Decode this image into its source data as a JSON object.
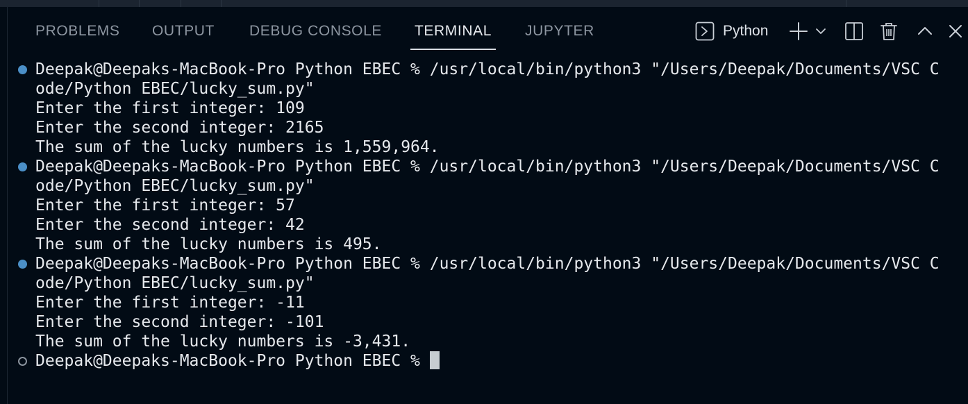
{
  "panel": {
    "tabs": [
      {
        "label": "PROBLEMS"
      },
      {
        "label": "OUTPUT"
      },
      {
        "label": "DEBUG CONSOLE"
      },
      {
        "label": "TERMINAL"
      },
      {
        "label": "JUPYTER"
      }
    ],
    "active_tab": "TERMINAL",
    "terminal_profile": "Python",
    "toolbar_icons": [
      "terminal-icon",
      "plus-icon",
      "chevron-down-icon",
      "split-icon",
      "trash-icon",
      "chevron-up-icon",
      "close-icon"
    ]
  },
  "terminal": {
    "lines": [
      {
        "text": "Deepak@Deepaks-MacBook-Pro Python EBEC % /usr/local/bin/python3 \"/Users/Deepak/Documents/VSC C",
        "marker": "filled"
      },
      {
        "text": "ode/Python EBEC/lucky_sum.py\"",
        "marker": "none"
      },
      {
        "text": "Enter the first integer: 109",
        "marker": "none"
      },
      {
        "text": "Enter the second integer: 2165",
        "marker": "none"
      },
      {
        "text": "The sum of the lucky numbers is 1,559,964.",
        "marker": "none"
      },
      {
        "text": "Deepak@Deepaks-MacBook-Pro Python EBEC % /usr/local/bin/python3 \"/Users/Deepak/Documents/VSC C",
        "marker": "filled"
      },
      {
        "text": "ode/Python EBEC/lucky_sum.py\"",
        "marker": "none"
      },
      {
        "text": "Enter the first integer: 57",
        "marker": "none"
      },
      {
        "text": "Enter the second integer: 42",
        "marker": "none"
      },
      {
        "text": "The sum of the lucky numbers is 495.",
        "marker": "none"
      },
      {
        "text": "Deepak@Deepaks-MacBook-Pro Python EBEC % /usr/local/bin/python3 \"/Users/Deepak/Documents/VSC C",
        "marker": "filled"
      },
      {
        "text": "ode/Python EBEC/lucky_sum.py\"",
        "marker": "none"
      },
      {
        "text": "Enter the first integer: -11",
        "marker": "none"
      },
      {
        "text": "Enter the second integer: -101",
        "marker": "none"
      },
      {
        "text": "The sum of the lucky numbers is -3,431.",
        "marker": "none"
      },
      {
        "text": "Deepak@Deepaks-MacBook-Pro Python EBEC %",
        "marker": "hollow"
      }
    ]
  },
  "colors": {
    "background": "#020b15",
    "text": "#e6e9ed",
    "tab_inactive": "#8d96a1",
    "tab_active": "#e7ebef",
    "success_marker": "#4b8fc7",
    "cursor": "#c7ccd1"
  }
}
